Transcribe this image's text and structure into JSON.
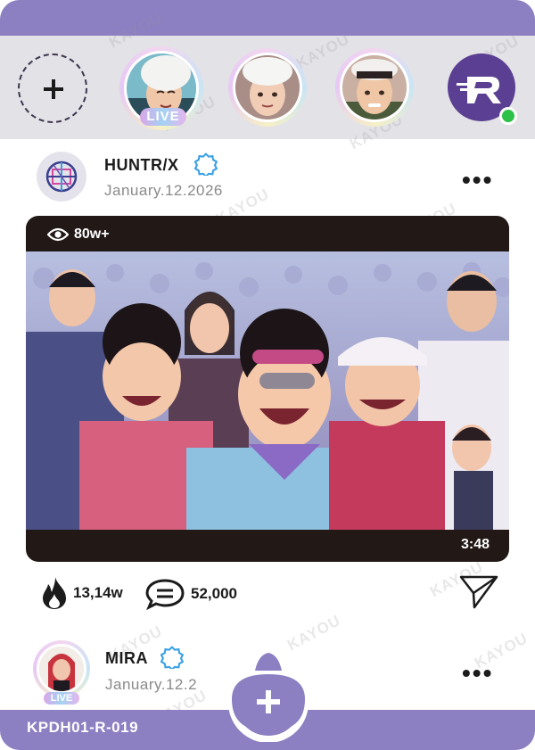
{
  "stories": {
    "add_label": "+",
    "live_label": "LIVE",
    "avatars": [
      "story-avatar-1",
      "story-avatar-2",
      "story-avatar-3"
    ],
    "brand_logo_icon": "r-logo-icon"
  },
  "post": {
    "username": "HUNTR/X",
    "date": "January.12.2026",
    "more_label": "•••",
    "views": "80w+",
    "duration": "3:48",
    "likes": "13,14w",
    "comments": "52,000"
  },
  "next_post": {
    "username": "MIRA",
    "date": "January.12.2",
    "more_label": "•••",
    "live_label": "LIVE"
  },
  "fab_label": "+",
  "card_code": "KPDH01-R-019",
  "watermark": "KAYOU",
  "colors": {
    "accent": "#8c7fc2",
    "story_bar": "#e3e2e6",
    "verified": "#3aa0e4",
    "online": "#2ec14a",
    "brand_logo": "#5b3f93"
  }
}
